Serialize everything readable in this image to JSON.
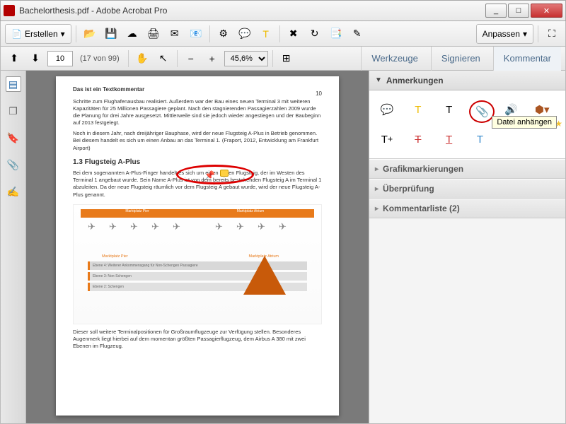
{
  "window": {
    "title": "Bachelorthesis.pdf - Adobe Acrobat Pro"
  },
  "toolbar": {
    "create": "Erstellen",
    "customize": "Anpassen"
  },
  "nav": {
    "page": "10",
    "page_info": "(17 von 99)",
    "zoom": "45,6%",
    "tools": "Werkzeuge",
    "sign": "Signieren",
    "comment": "Kommentar"
  },
  "doc": {
    "comment_label": "Das ist ein Textkommentar",
    "page_number": "10",
    "para1": "Schritte zum Flughafenausbau realisiert. Außerdem war der Bau eines neuen Terminal 3 mit weiteren Kapazitäten für 25 Millionen Passagiere geplant. Nach den stagnierenden Passagierzahlen 2009 wurde die Planung für drei Jahre ausgesetzt. Mittlerweile sind sie jedoch wieder angestiegen und der Baubeginn auf 2013 festgelegt.",
    "para2": "Noch in diesem Jahr, nach dreijähriger Bauphase, wird der neue Flugsteig A-Plus in Betrieb genommen. Bei diesem handelt es sich um einen Anbau an das Terminal 1. (Fraport, 2012, Entwicklung am Frankfurt Airport)",
    "heading": "1.3 Flugsteig A-Plus",
    "para3": "Bei dem sogenannten A-Plus-Finger handelt es sich um einen neuen Flugsteig, der im Westen des Terminal 1 angebaut wurde. Sein Name A-Plus ist von dem bereits bestehenden Flugsteig A im Terminal 1 abzuleiten. Da der neue Flugsteig räumlich vor dem Flugsteig A gebaut wurde, wird der neue Flugsteig A-Plus genannt.",
    "diag_pier": "Marktplatz Pier",
    "diag_atrium": "Marktplatz Atrium",
    "zone4": "Ebene 4: Weiterer Ankommensgang für Non-Schengen Passagiere",
    "zone3": "Ebene 3: Non-Schengen",
    "zone2": "Ebene 2: Schengen",
    "para4": "Dieser soll weitere Terminalpositionen für Großraumflugzeuge zur Verfügung stellen. Besonderes Augenmerk liegt hierbei auf dem momentan größten Passagierflugzeug, dem Airbus A 380 mit zwei Ebenen im Flugzeug."
  },
  "panel": {
    "annotations": "Anmerkungen",
    "tooltip": "Datei anhängen",
    "graphics": "Grafikmarkierungen",
    "review": "Überprüfung",
    "commentlist": "Kommentarliste (2)"
  }
}
